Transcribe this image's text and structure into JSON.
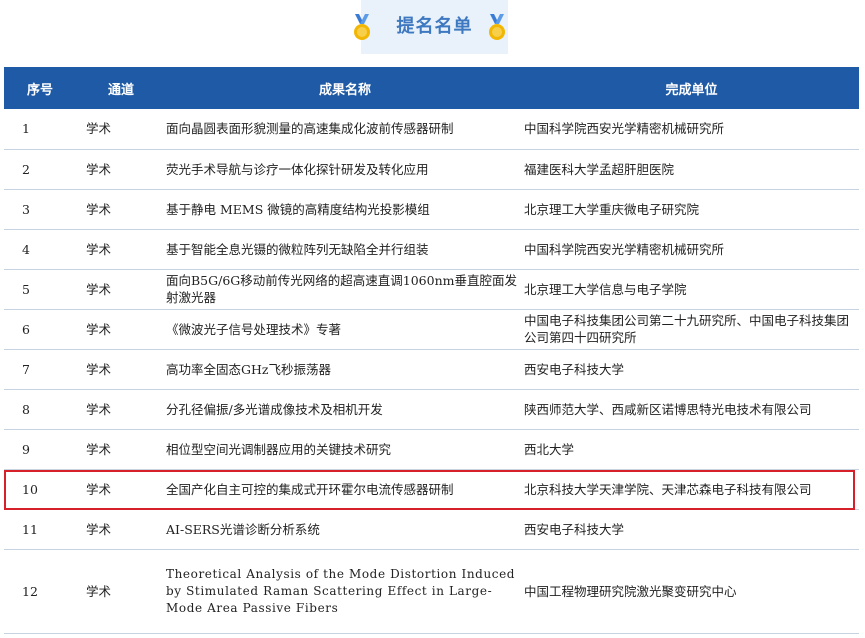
{
  "banner": {
    "title": "提名名单"
  },
  "table": {
    "headers": [
      "序号",
      "通道",
      "成果名称",
      "完成单位"
    ],
    "rows": [
      {
        "index": "1",
        "track": "学术",
        "name": "面向晶圆表面形貌测量的高速集成化波前传感器研制",
        "unit": "中国科学院西安光学精密机械研究所"
      },
      {
        "index": "2",
        "track": "学术",
        "name": "荧光手术导航与诊疗一体化探针研发及转化应用",
        "unit": "福建医科大学孟超肝胆医院"
      },
      {
        "index": "3",
        "track": "学术",
        "name": "基于静电 MEMS 微镜的高精度结构光投影模组",
        "unit": "北京理工大学重庆微电子研究院"
      },
      {
        "index": "4",
        "track": "学术",
        "name": "基于智能全息光镊的微粒阵列无缺陷全并行组装",
        "unit": "中国科学院西安光学精密机械研究所"
      },
      {
        "index": "5",
        "track": "学术",
        "name": "面向B5G/6G移动前传光网络的超高速直调1060nm垂直腔面发射激光器",
        "unit": "北京理工大学信息与电子学院"
      },
      {
        "index": "6",
        "track": "学术",
        "name": "《微波光子信号处理技术》专著",
        "unit": "中国电子科技集团公司第二十九研究所、中国电子科技集团公司第四十四研究所"
      },
      {
        "index": "7",
        "track": "学术",
        "name": "高功率全固态GHz飞秒振荡器",
        "unit": "西安电子科技大学"
      },
      {
        "index": "8",
        "track": "学术",
        "name": "分孔径偏振/多光谱成像技术及相机开发",
        "unit": "陕西师范大学、西咸新区诺博思特光电技术有限公司"
      },
      {
        "index": "9",
        "track": "学术",
        "name": "相位型空间光调制器应用的关键技术研究",
        "unit": "西北大学"
      },
      {
        "index": "10",
        "track": "学术",
        "name": "全国产化自主可控的集成式开环霍尔电流传感器研制",
        "unit": "北京科技大学天津学院、天津芯森电子科技有限公司"
      },
      {
        "index": "11",
        "track": "学术",
        "name": "AI-SERS光谱诊断分析系统",
        "unit": "西安电子科技大学"
      },
      {
        "index": "12",
        "track": "学术",
        "name": "Theoretical Analysis of the Mode Distortion Induced by Stimulated Raman Scattering Effect in Large-Mode Area Passive Fibers",
        "unit": "中国工程物理研究院激光聚变研究中心"
      }
    ]
  },
  "colors": {
    "header_bg": "#1e5aa6",
    "highlight": "#d6202a",
    "banner_text": "#3d78c0"
  }
}
